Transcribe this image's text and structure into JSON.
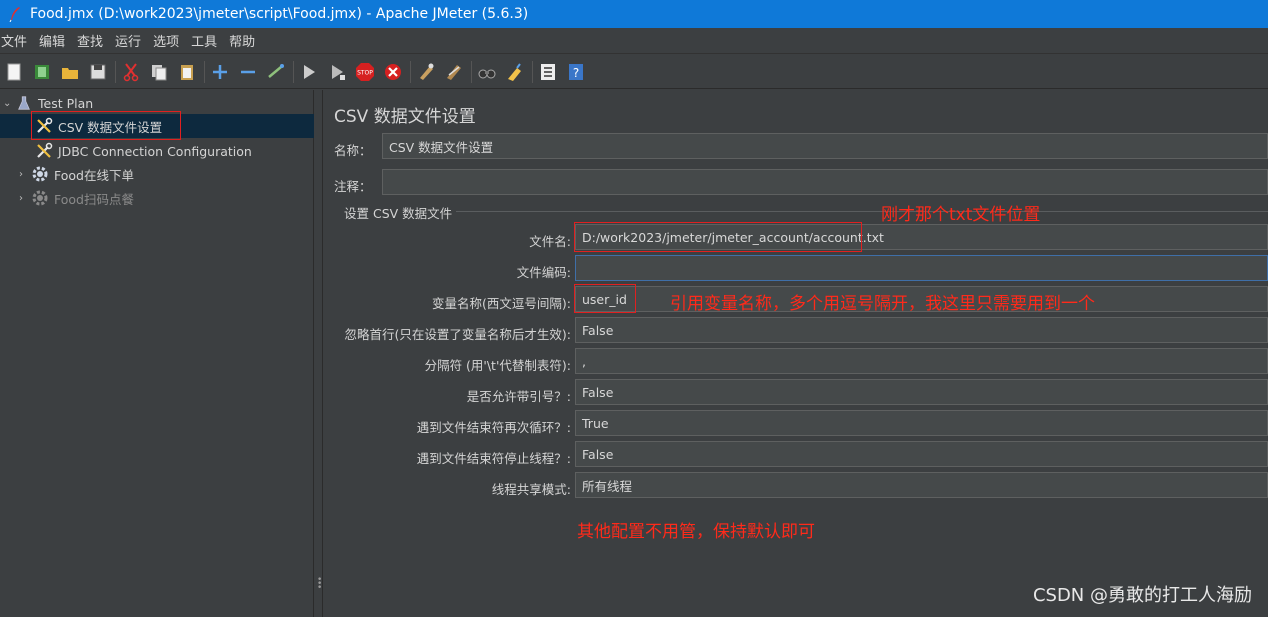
{
  "window": {
    "title": "Food.jmx (D:\\work2023\\jmeter\\script\\Food.jmx) - Apache JMeter (5.6.3)"
  },
  "menu": [
    "文件",
    "编辑",
    "查找",
    "运行",
    "选项",
    "工具",
    "帮助"
  ],
  "toolbar_icons": [
    "new-icon",
    "templates-icon",
    "open-icon",
    "save-icon",
    "cut-icon",
    "copy-icon",
    "paste-icon",
    "expand-icon",
    "collapse-icon",
    "toggle-icon",
    "start-icon",
    "start-no-pause-icon",
    "stop-icon",
    "shutdown-icon",
    "clear-icon",
    "clear-all-icon",
    "search-icon",
    "reset-search-icon",
    "function-helper-icon",
    "help-icon"
  ],
  "tree": {
    "test_plan": "Test Plan",
    "csv_config": "CSV 数据文件设置",
    "jdbc_config": "JDBC Connection Configuration",
    "thread_group_1": "Food在线下单",
    "thread_group_2": "Food扫码点餐"
  },
  "panel": {
    "title": "CSV 数据文件设置",
    "name_label": "名称：",
    "name_value": "CSV 数据文件设置",
    "comment_label": "注释：",
    "comment_value": "",
    "group_title": "设置 CSV 数据文件",
    "fields": [
      {
        "label": "文件名:",
        "value": "D:/work2023/jmeter/jmeter_account/account.txt"
      },
      {
        "label": "文件编码:",
        "value": ""
      },
      {
        "label": "变量名称(西文逗号间隔):",
        "value": "user_id"
      },
      {
        "label": "忽略首行(只在设置了变量名称后才生效):",
        "value": "False"
      },
      {
        "label": "分隔符 (用'\\t'代替制表符):",
        "value": ","
      },
      {
        "label": "是否允许带引号？:",
        "value": "False"
      },
      {
        "label": "遇到文件结束符再次循环？:",
        "value": "True"
      },
      {
        "label": "遇到文件结束符停止线程？:",
        "value": "False"
      },
      {
        "label": "线程共享模式:",
        "value": "所有线程"
      }
    ]
  },
  "annotations": {
    "filename_note": "刚才那个txt文件位置",
    "variable_note": "引用变量名称，多个用逗号隔开，我这里只需要用到一个",
    "other_note": "其他配置不用管，保持默认即可"
  },
  "watermark": "CSDN @勇敢的打工人海励",
  "colors": {
    "titlebar": "#0f79d8",
    "background": "#3c3f41",
    "selection": "#0d293e",
    "annotation": "#ff2a1a"
  }
}
